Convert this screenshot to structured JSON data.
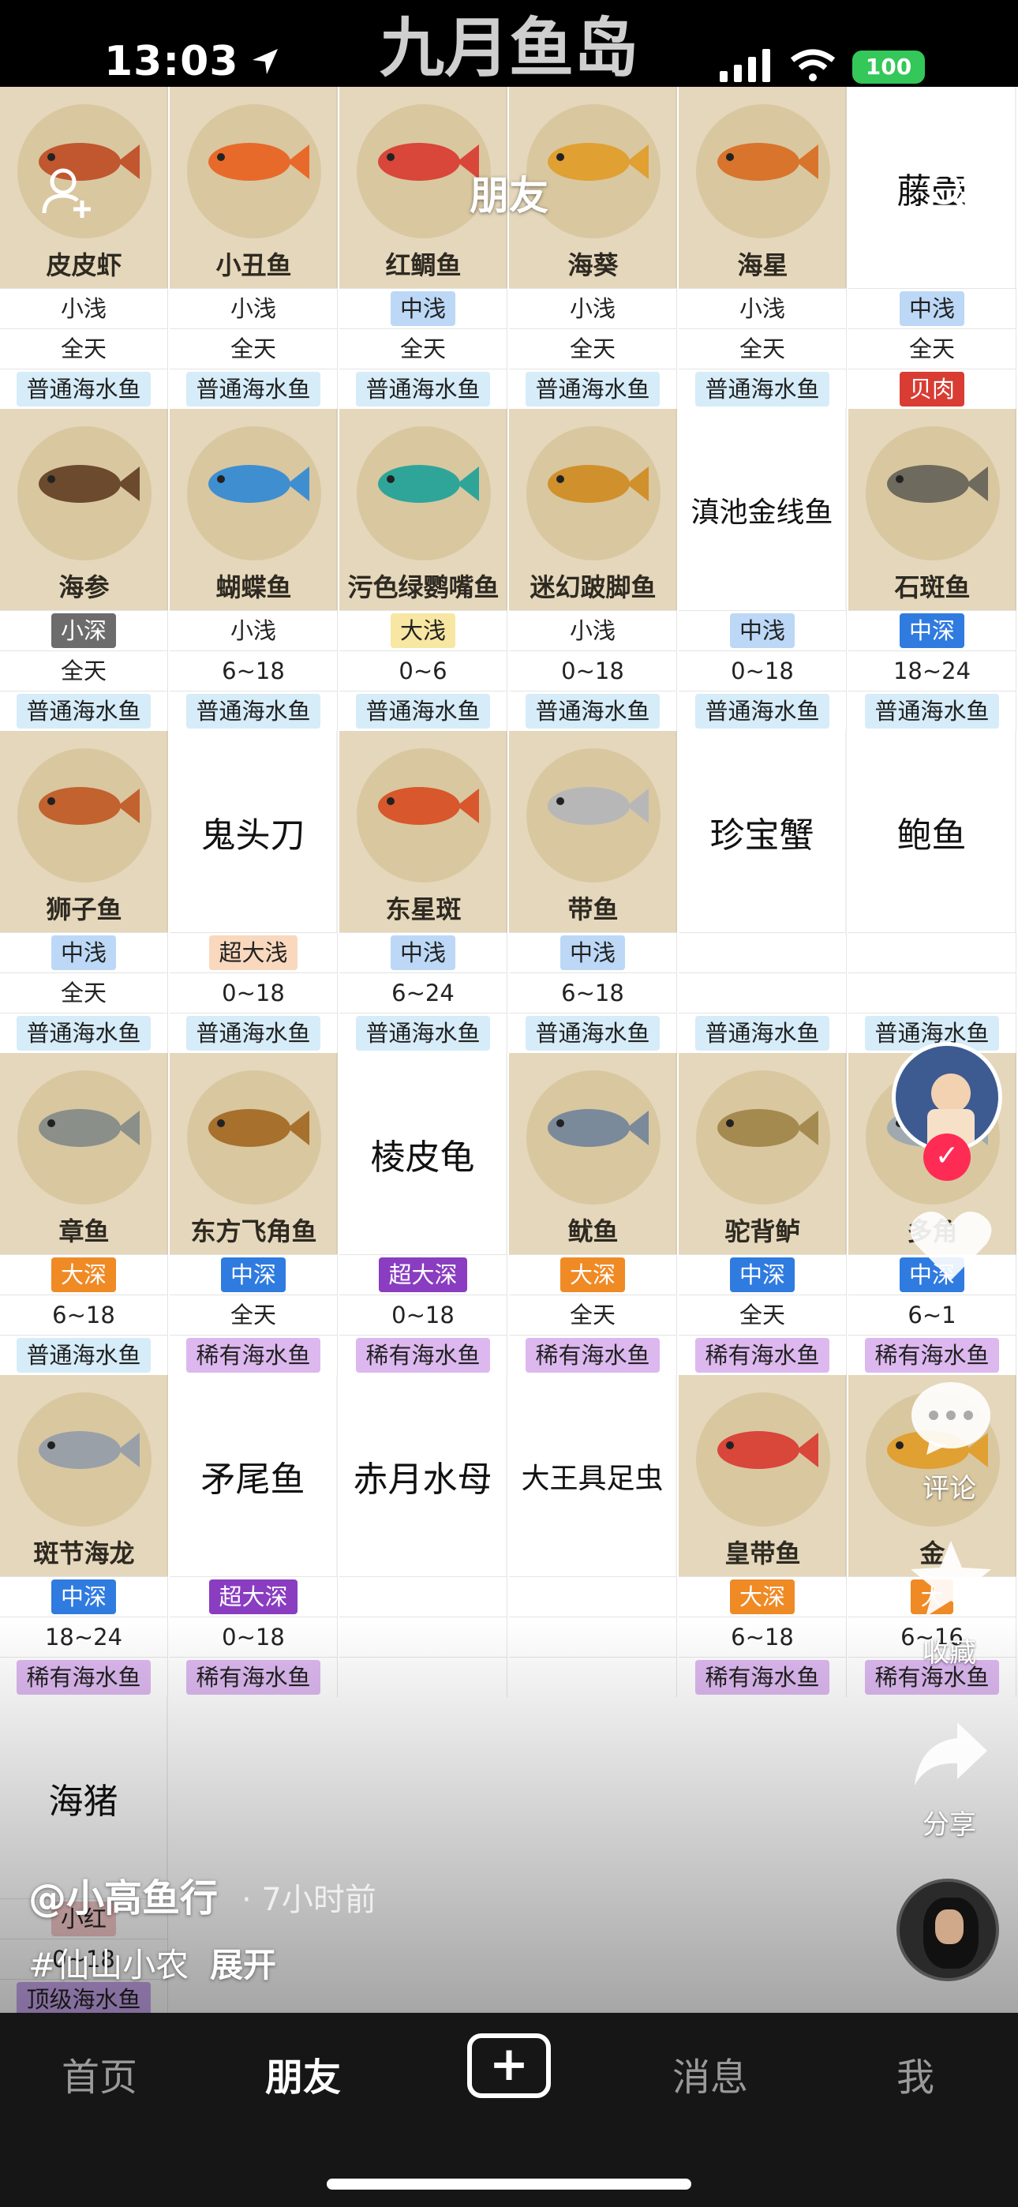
{
  "status_bar": {
    "time": "13:03",
    "battery": "100"
  },
  "page_title": "九月鱼岛",
  "top_tab": "朋友",
  "grid": [
    {
      "name": "皮皮虾",
      "type": "img",
      "icon": "shrimp-icon",
      "size": "小浅",
      "size_color": "none",
      "time": "全天",
      "category": "普通海水鱼",
      "cat_color": "#d6ecf8"
    },
    {
      "name": "小丑鱼",
      "type": "img",
      "icon": "clownfish-icon",
      "size": "小浅",
      "size_color": "none",
      "time": "全天",
      "category": "普通海水鱼",
      "cat_color": "#d6ecf8"
    },
    {
      "name": "红鲷鱼",
      "type": "img",
      "icon": "snapper-icon",
      "size": "中浅",
      "size_color": "#bcd8f6",
      "time": "全天",
      "category": "普通海水鱼",
      "cat_color": "#d6ecf8"
    },
    {
      "name": "海葵",
      "type": "img",
      "icon": "anemone-icon",
      "size": "小浅",
      "size_color": "none",
      "time": "全天",
      "category": "普通海水鱼",
      "cat_color": "#d6ecf8"
    },
    {
      "name": "海星",
      "type": "img",
      "icon": "starfish-icon",
      "size": "小浅",
      "size_color": "none",
      "time": "全天",
      "category": "普通海水鱼",
      "cat_color": "#d6ecf8"
    },
    {
      "name": "藤壶",
      "type": "text",
      "size": "中浅",
      "size_color": "#bcd8f6",
      "time": "全天",
      "category": "贝肉",
      "cat_color": "#d93c33"
    },
    {
      "name": "海参",
      "type": "img",
      "icon": "sea-cucumber-icon",
      "size": "小深",
      "size_color": "#6c6c6c",
      "time": "全天",
      "category": "普通海水鱼",
      "cat_color": "#d6ecf8"
    },
    {
      "name": "蝴蝶鱼",
      "type": "img",
      "icon": "butterflyfish-icon",
      "size": "小浅",
      "size_color": "none",
      "time": "6~18",
      "category": "普通海水鱼",
      "cat_color": "#d6ecf8"
    },
    {
      "name": "污色绿鹦嘴鱼",
      "type": "img",
      "icon": "parrotfish-icon",
      "size": "大浅",
      "size_color": "#f8e7a2",
      "time": "0~6",
      "category": "普通海水鱼",
      "cat_color": "#d6ecf8"
    },
    {
      "name": "迷幻跛脚鱼",
      "type": "img",
      "icon": "frogfish-icon",
      "size": "小浅",
      "size_color": "none",
      "time": "0~18",
      "category": "普通海水鱼",
      "cat_color": "#d6ecf8"
    },
    {
      "name": "滇池金线鱼",
      "type": "text",
      "size": "中浅",
      "size_color": "#bcd8f6",
      "time": "0~18",
      "category": "普通海水鱼",
      "cat_color": "#d6ecf8"
    },
    {
      "name": "石斑鱼",
      "type": "img",
      "icon": "grouper-icon",
      "size": "中深",
      "size_color": "#2f7be0",
      "time": "18~24",
      "category": "普通海水鱼",
      "cat_color": "#d6ecf8"
    },
    {
      "name": "狮子鱼",
      "type": "img",
      "icon": "lionfish-icon",
      "size": "中浅",
      "size_color": "#bcd8f6",
      "time": "全天",
      "category": "普通海水鱼",
      "cat_color": "#d6ecf8"
    },
    {
      "name": "鬼头刀",
      "type": "text",
      "size": "超大浅",
      "size_color": "#f9d8bd",
      "time": "0~18",
      "category": "普通海水鱼",
      "cat_color": "#d6ecf8"
    },
    {
      "name": "东星斑",
      "type": "img",
      "icon": "coral-grouper-icon",
      "size": "中浅",
      "size_color": "#bcd8f6",
      "time": "6~24",
      "category": "普通海水鱼",
      "cat_color": "#d6ecf8"
    },
    {
      "name": "带鱼",
      "type": "img",
      "icon": "hairtail-icon",
      "size": "中浅",
      "size_color": "#bcd8f6",
      "time": "6~18",
      "category": "普通海水鱼",
      "cat_color": "#d6ecf8"
    },
    {
      "name": "珍宝蟹",
      "type": "text",
      "size": "",
      "size_color": "none",
      "time": "",
      "category": "普通海水鱼",
      "cat_color": "#d6ecf8"
    },
    {
      "name": "鲍鱼",
      "type": "text",
      "size": "",
      "size_color": "none",
      "time": "",
      "category": "普通海水鱼",
      "cat_color": "#d6ecf8"
    },
    {
      "name": "章鱼",
      "type": "img",
      "icon": "octopus-icon",
      "size": "大深",
      "size_color": "#ef8a25",
      "time": "6~18",
      "category": "普通海水鱼",
      "cat_color": "#d6ecf8"
    },
    {
      "name": "东方飞角鱼",
      "type": "img",
      "icon": "gurnard-icon",
      "size": "中深",
      "size_color": "#2f7be0",
      "time": "全天",
      "category": "稀有海水鱼",
      "cat_color": "#dcb8ef"
    },
    {
      "name": "棱皮龟",
      "type": "text",
      "size": "超大深",
      "size_color": "#8a3dc0",
      "time": "0~18",
      "category": "稀有海水鱼",
      "cat_color": "#dcb8ef"
    },
    {
      "name": "鱿鱼",
      "type": "img",
      "icon": "squid-icon",
      "size": "大深",
      "size_color": "#ef8a25",
      "time": "全天",
      "category": "稀有海水鱼",
      "cat_color": "#dcb8ef"
    },
    {
      "name": "驼背鲈",
      "type": "img",
      "icon": "humpback-grouper-icon",
      "size": "中深",
      "size_color": "#2f7be0",
      "time": "全天",
      "category": "稀有海水鱼",
      "cat_color": "#dcb8ef"
    },
    {
      "name": "多角",
      "type": "img",
      "icon": "pufferfish-icon",
      "size": "中深",
      "size_color": "#2f7be0",
      "time": "6~1",
      "category": "稀有海水鱼",
      "cat_color": "#dcb8ef"
    },
    {
      "name": "斑节海龙",
      "type": "img",
      "icon": "pipefish-icon",
      "size": "中深",
      "size_color": "#2f7be0",
      "time": "18~24",
      "category": "稀有海水鱼",
      "cat_color": "#dcb8ef"
    },
    {
      "name": "矛尾鱼",
      "type": "text",
      "size": "超大深",
      "size_color": "#8a3dc0",
      "time": "0~18",
      "category": "稀有海水鱼",
      "cat_color": "#dcb8ef"
    },
    {
      "name": "赤月水母",
      "type": "text",
      "size": "",
      "size_color": "none",
      "time": "",
      "category": "",
      "cat_color": "none"
    },
    {
      "name": "大王具足虫",
      "type": "text",
      "size": "",
      "size_color": "none",
      "time": "",
      "category": "",
      "cat_color": "none"
    },
    {
      "name": "皇带鱼",
      "type": "img",
      "icon": "oarfish-icon",
      "size": "大深",
      "size_color": "#ef8a25",
      "time": "6~18",
      "category": "稀有海水鱼",
      "cat_color": "#dcb8ef"
    },
    {
      "name": "金",
      "type": "img",
      "icon": "tuna-icon",
      "size": "大",
      "size_color": "#ef8a25",
      "time": "6~16",
      "category": "稀有海水鱼",
      "cat_color": "#dcb8ef"
    },
    {
      "name": "海猪",
      "type": "text",
      "size": "小红",
      "size_color": "#f3c7c7",
      "time": "0~18",
      "category": "顶级海水鱼",
      "cat_color": "#c9a7ee"
    }
  ],
  "side_actions": {
    "comment": "评论",
    "favorite": "收藏",
    "share": "分享"
  },
  "author": {
    "handle": "@小高鱼行",
    "time": "· 7小时前",
    "tag": "#仙山小农",
    "expand": "展开"
  },
  "nav": {
    "home": "首页",
    "friends": "朋友",
    "messages": "消息",
    "me": "我"
  }
}
